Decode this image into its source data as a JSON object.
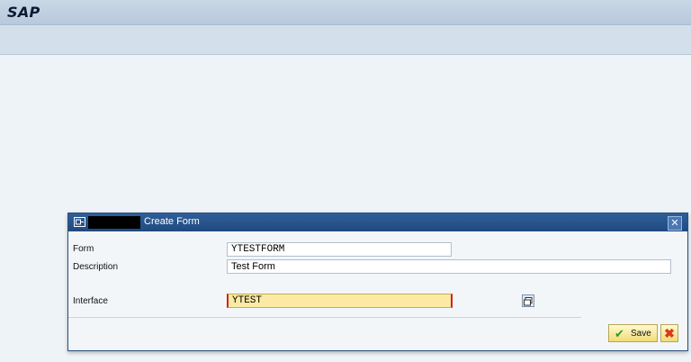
{
  "app": {
    "logo": "SAP"
  },
  "dialog": {
    "title": "Create Form",
    "fields": {
      "form": {
        "label": "Form",
        "value": "YTESTFORM"
      },
      "description": {
        "label": "Description",
        "value": "Test Form"
      },
      "interface": {
        "label": "Interface",
        "value": "YTEST"
      }
    },
    "buttons": {
      "save": "Save",
      "cancel_icon": "cancel-x-icon",
      "close_icon": "close-icon"
    }
  },
  "colors": {
    "title_bar": "#2f5f98",
    "required_field": "#fbeaa3",
    "button": "#f1dc77",
    "accent_red": "#d61f1f"
  }
}
